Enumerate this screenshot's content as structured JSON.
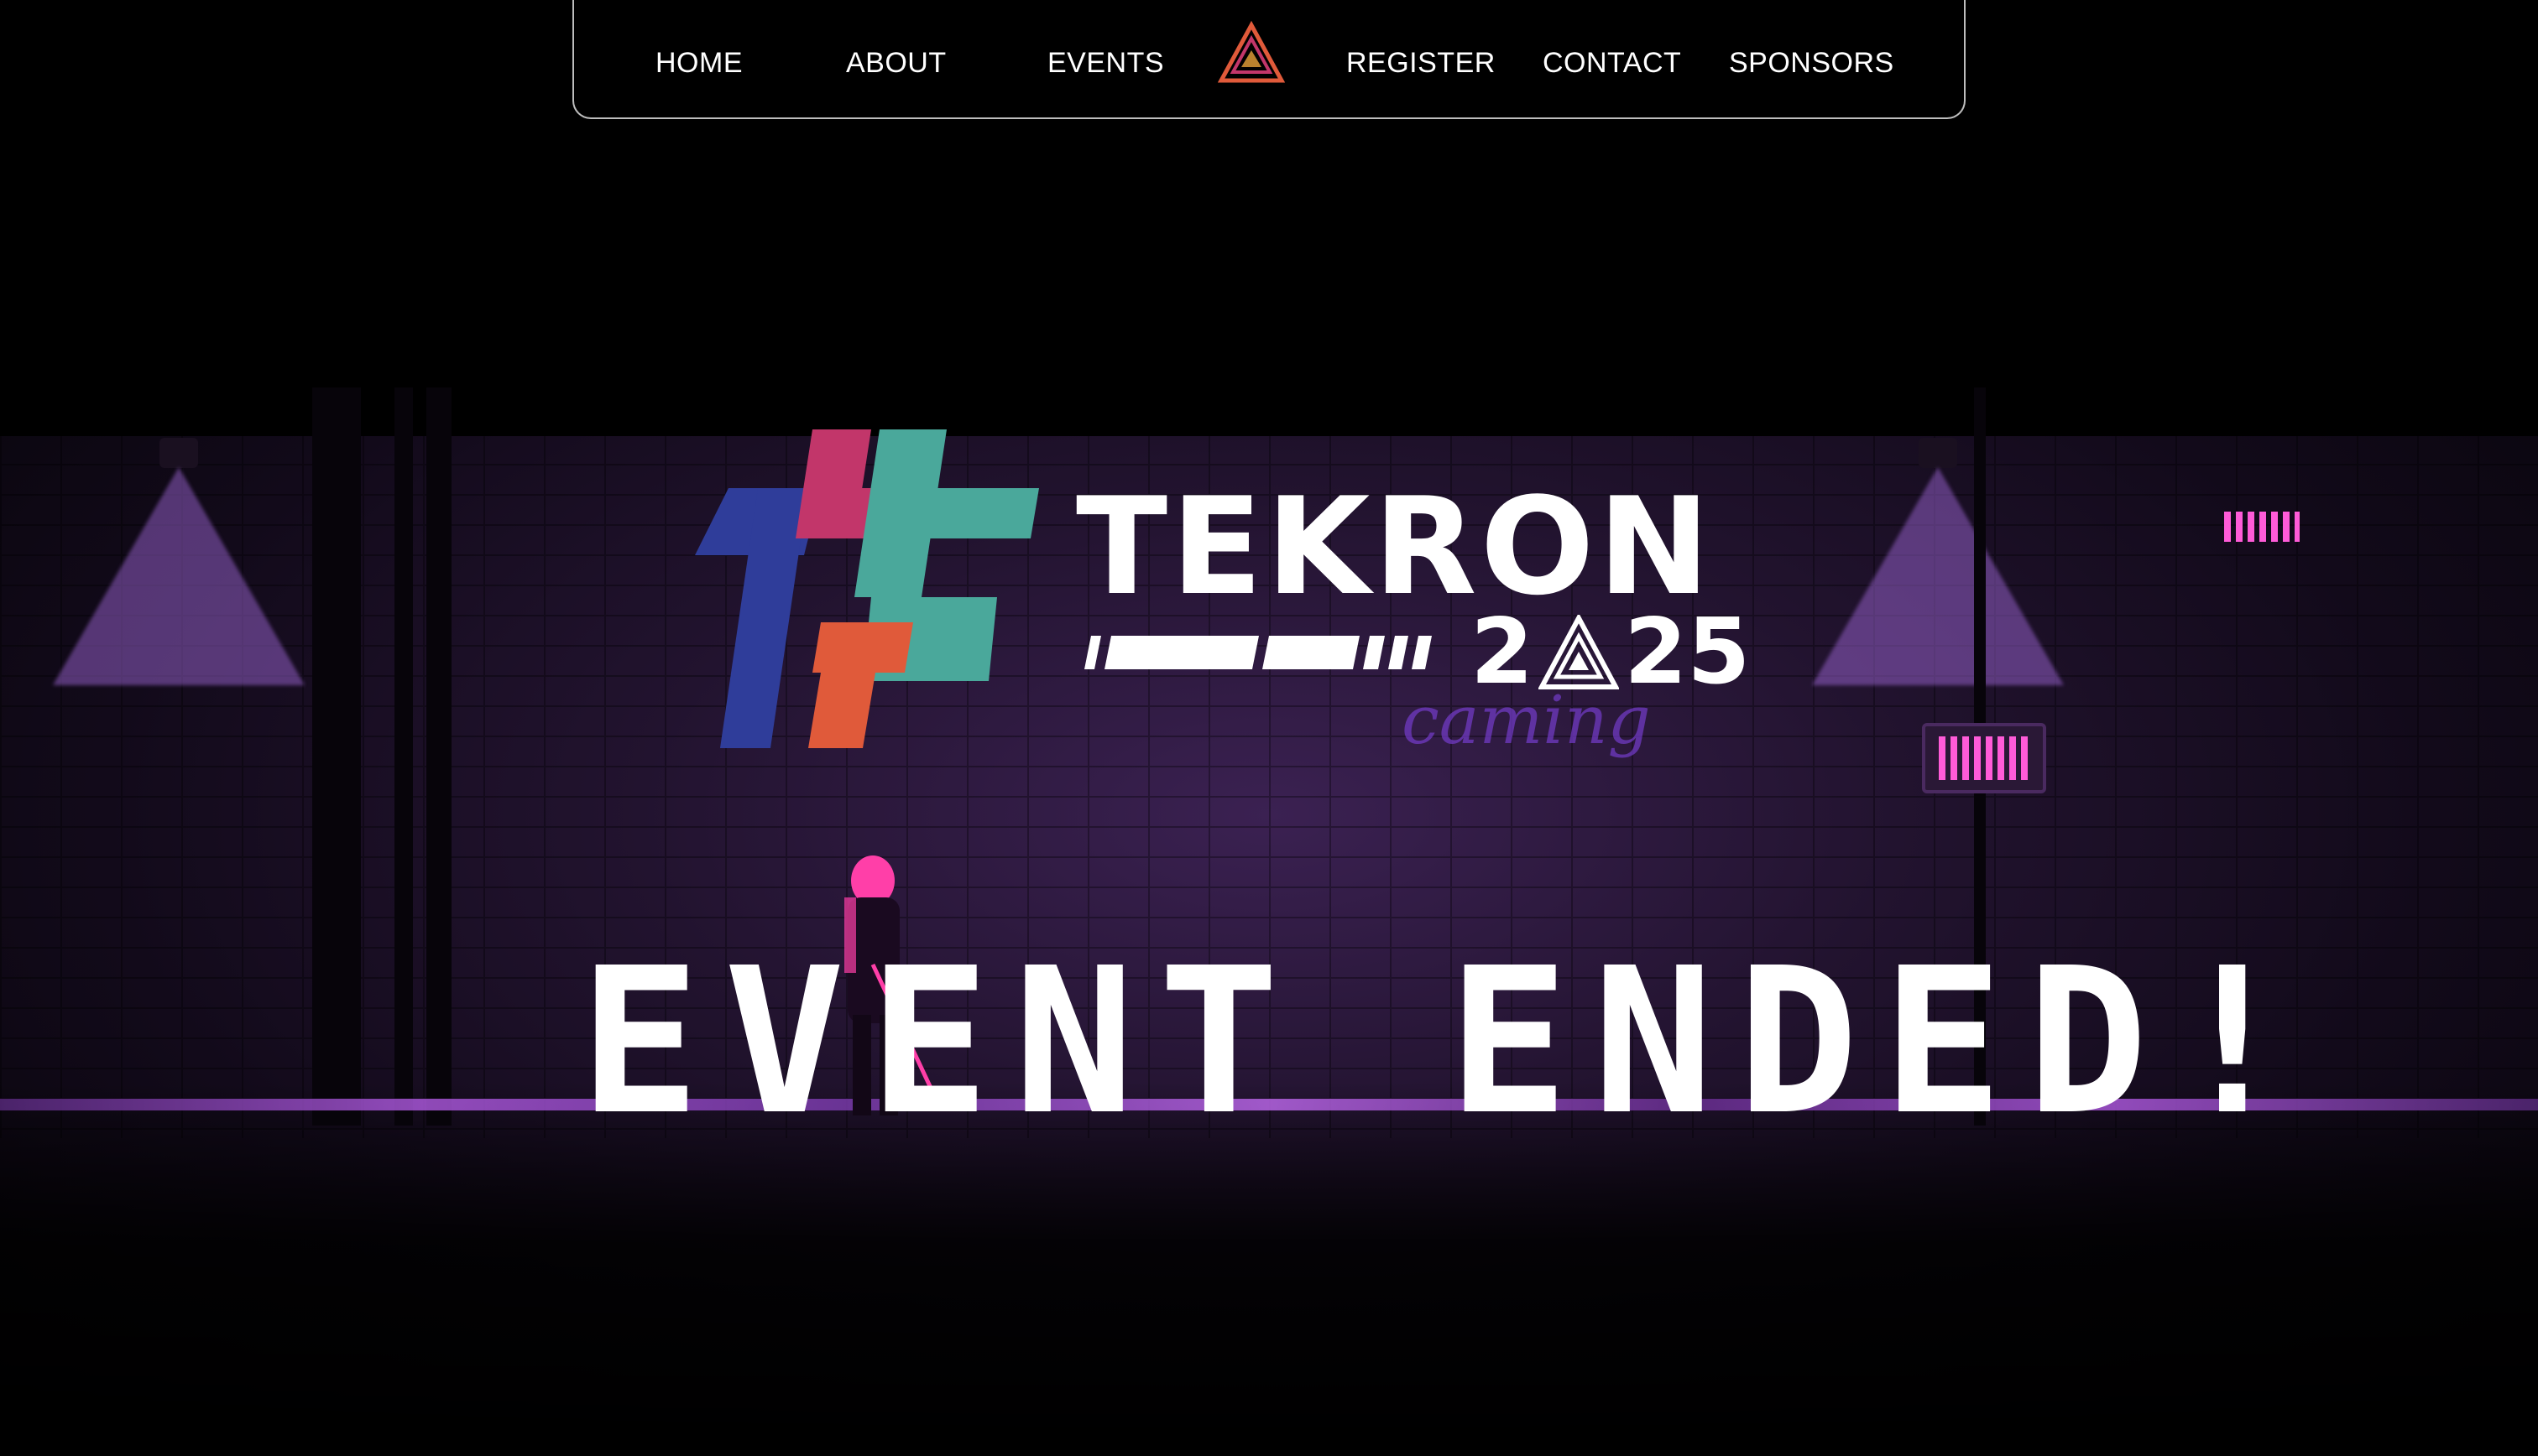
{
  "nav": {
    "items": [
      {
        "label": "HOME"
      },
      {
        "label": "ABOUT"
      },
      {
        "label": "EVENTS"
      },
      {
        "label": "REGISTER"
      },
      {
        "label": "CONTACT"
      },
      {
        "label": "SPONSORS"
      }
    ],
    "logo_icon": "tekron-triangle-logo-icon"
  },
  "hero": {
    "brand_word": "TEKRON",
    "brand_year_left": "2",
    "brand_year_right": "25",
    "headline": "EVENT ENDED!",
    "graffiti_text": "caming",
    "colors": {
      "background": "#000000",
      "accent_purple": "#b15be3",
      "neon_pink": "#ff5bd8",
      "logo_blue": "#2f3d9a",
      "logo_magenta": "#c2366a",
      "logo_teal": "#4aa89b",
      "logo_orange": "#e05a3a"
    }
  }
}
